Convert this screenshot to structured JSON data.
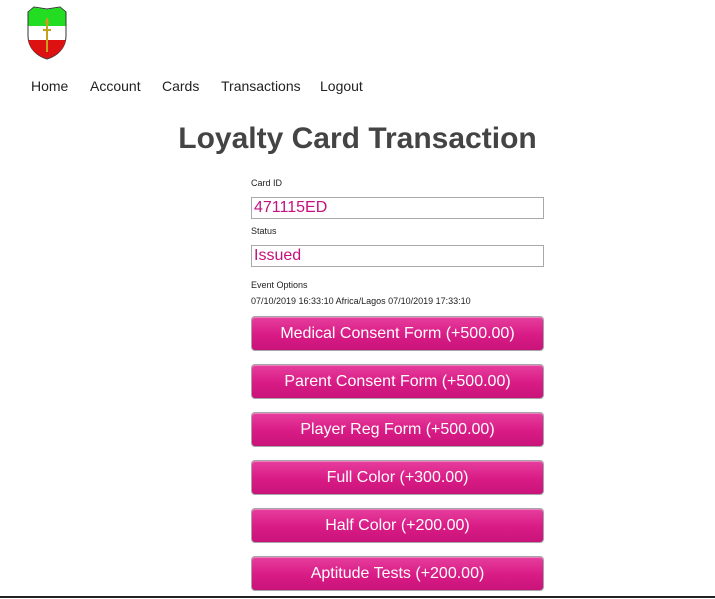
{
  "nav": {
    "home": "Home",
    "account": "Account",
    "cards": "Cards",
    "transactions": "Transactions",
    "logout": "Logout"
  },
  "page_title": "Loyalty Card Transaction",
  "form": {
    "card_id_label": "Card ID",
    "card_id_value": "471115ED",
    "status_label": "Status",
    "status_value": "Issued",
    "event_options_label": "Event Options",
    "event_dates": "07/10/2019 16:33:10 Africa/Lagos 07/10/2019 17:33:10"
  },
  "buttons": [
    "Medical Consent Form (+500.00)",
    "Parent Consent Form (+500.00)",
    "Player Reg Form (+500.00)",
    "Full Color (+300.00)",
    "Half Color (+200.00)",
    "Aptitude Tests (+200.00)"
  ],
  "colors": {
    "accent": "#d91b85",
    "field_text": "#c4117d",
    "logo_top": "#22dd22",
    "logo_bottom": "#dd1111"
  }
}
